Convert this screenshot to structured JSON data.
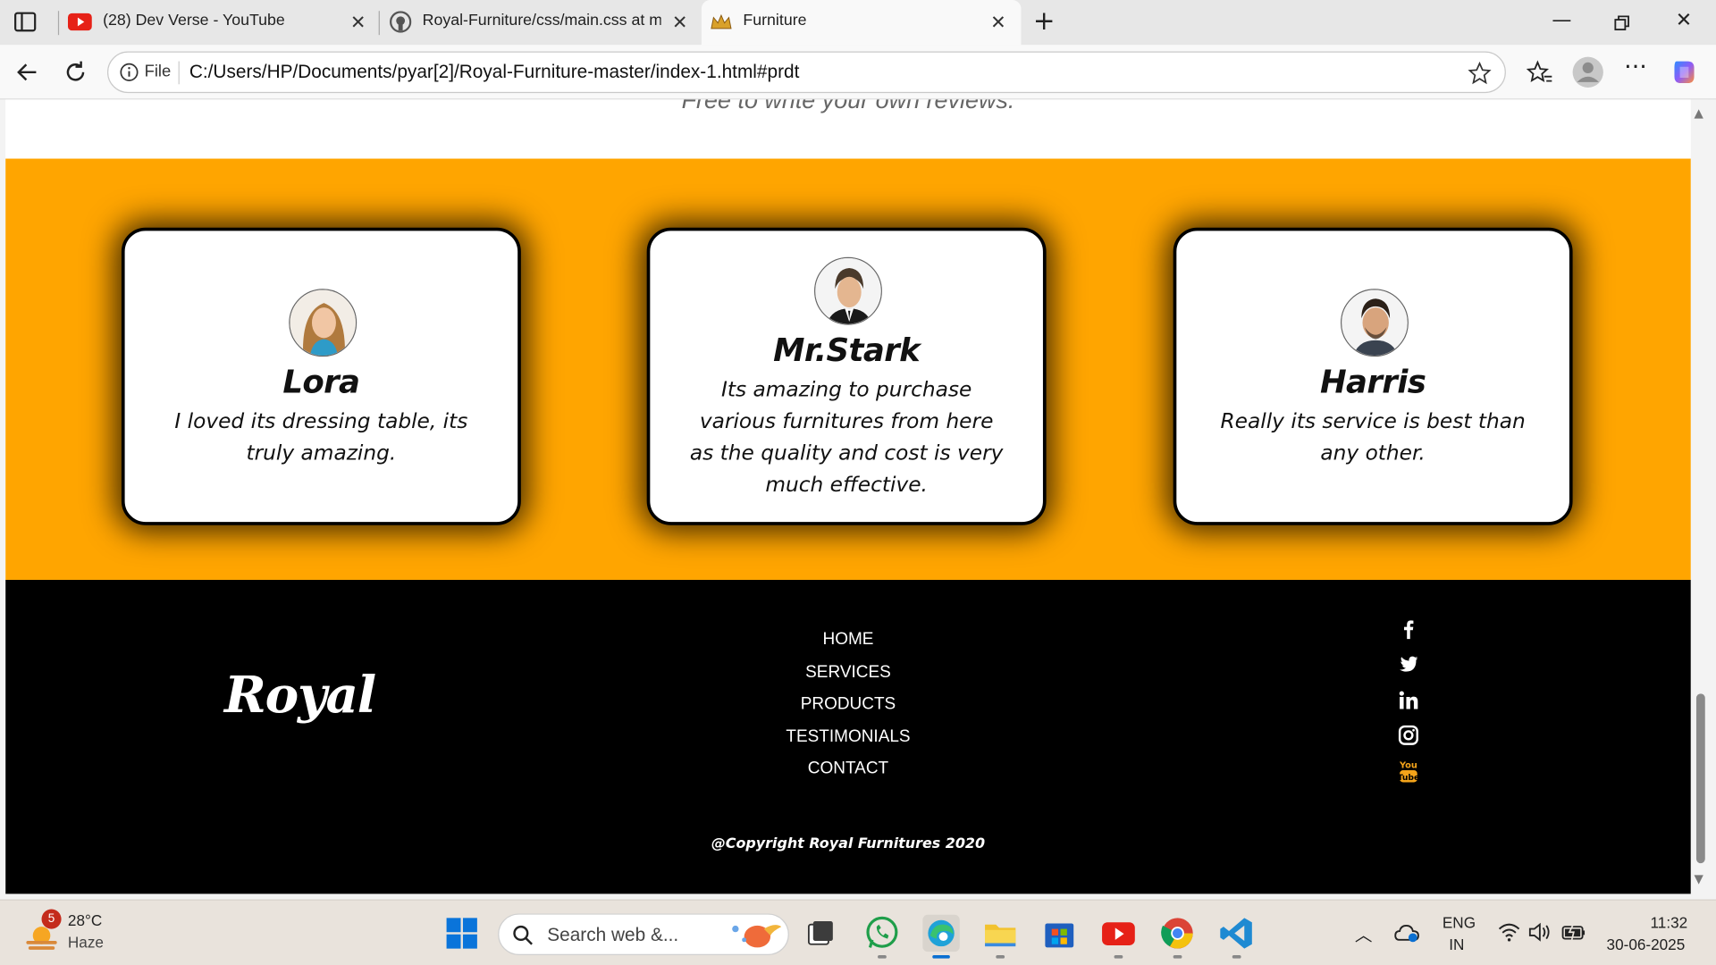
{
  "browser": {
    "tabs": [
      {
        "title": "(28) Dev Verse - YouTube",
        "icon": "youtube-icon"
      },
      {
        "title": "Royal-Furniture/css/main.css at m",
        "icon": "github-icon"
      },
      {
        "title": "Furniture",
        "icon": "crown-icon",
        "active": true
      }
    ],
    "address": {
      "scheme_label": "File",
      "url": "C:/Users/HP/Documents/pyar[2]/Royal-Furniture-master/index-1.html#prdt"
    }
  },
  "page": {
    "reviews_subtitle": "Free to write your own reviews.",
    "testimonials": [
      {
        "name": "Lora",
        "text": "I loved its dressing table, its truly amazing."
      },
      {
        "name": "Mr.Stark",
        "text": "Its amazing to purchase various furnitures from here as the quality and cost is very much effective."
      },
      {
        "name": "Harris",
        "text": "Really its service is best than any other."
      }
    ],
    "colors": {
      "band": "#ffa500",
      "footer": "#000000",
      "youtube_accent": "#f4a41a"
    },
    "footer": {
      "logo": "Royal",
      "links": [
        "HOME",
        "SERVICES",
        "PRODUCTS",
        "TESTIMONIALS",
        "CONTACT"
      ],
      "social": [
        "facebook-icon",
        "twitter-icon",
        "linkedin-icon",
        "instagram-icon",
        "youtube-icon"
      ],
      "copyright": "@Copyright Royal Furnitures 2020"
    }
  },
  "taskbar": {
    "weather": {
      "badge": "5",
      "temp": "28°C",
      "condition": "Haze"
    },
    "search_placeholder": "Search web &...",
    "language": {
      "lang": "ENG",
      "region": "IN"
    },
    "clock": {
      "time": "11:32",
      "date": "30-06-2025"
    }
  }
}
